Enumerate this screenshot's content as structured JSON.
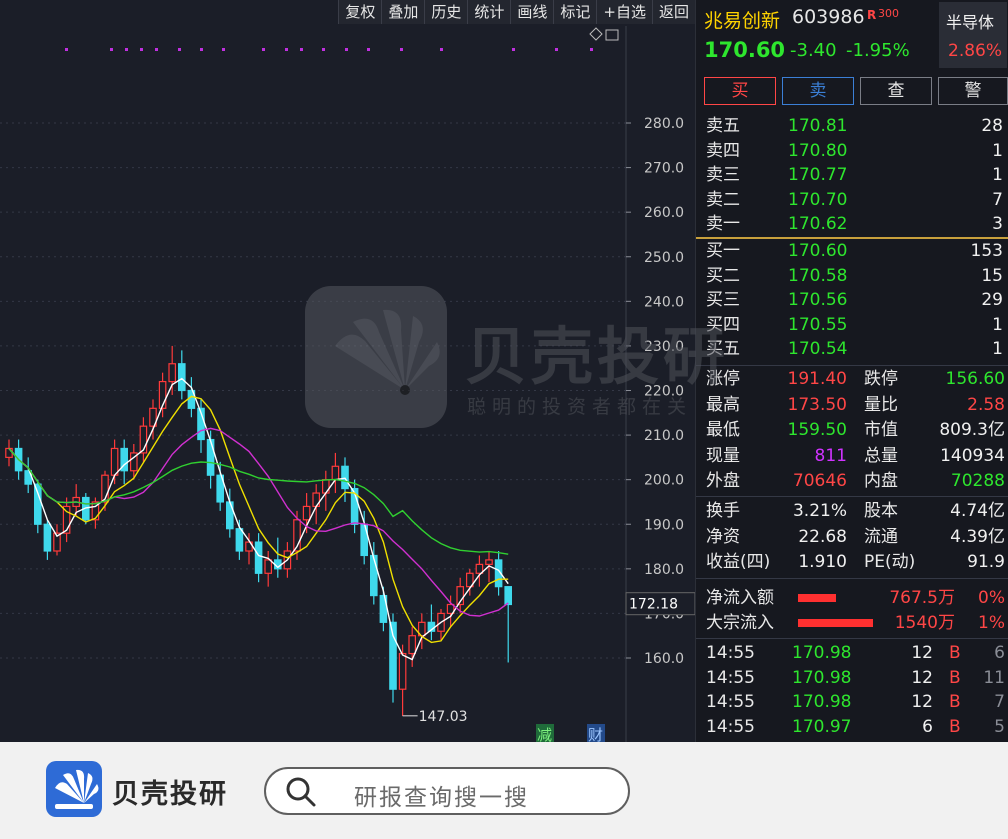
{
  "toolbar": {
    "buttons": [
      "复权",
      "叠加",
      "历史",
      "统计",
      "画线",
      "标记",
      "+自选",
      "返回"
    ]
  },
  "stock": {
    "name": "兆易创新",
    "code": "603986",
    "tag": "R",
    "tag_num": "300",
    "price": "170.60",
    "change": "-3.40",
    "change_pct": "-1.95%",
    "sector": "半导体",
    "sector_pct": "2.86%"
  },
  "actions": {
    "buy": "买",
    "sell": "卖",
    "check": "查",
    "alert": "警"
  },
  "asks": [
    {
      "label": "卖五",
      "price": "170.81",
      "vol": "28"
    },
    {
      "label": "卖四",
      "price": "170.80",
      "vol": "1"
    },
    {
      "label": "卖三",
      "price": "170.77",
      "vol": "1"
    },
    {
      "label": "卖二",
      "price": "170.70",
      "vol": "7"
    },
    {
      "label": "卖一",
      "price": "170.62",
      "vol": "3"
    }
  ],
  "bids": [
    {
      "label": "买一",
      "price": "170.60",
      "vol": "153"
    },
    {
      "label": "买二",
      "price": "170.58",
      "vol": "15"
    },
    {
      "label": "买三",
      "price": "170.56",
      "vol": "29"
    },
    {
      "label": "买四",
      "price": "170.55",
      "vol": "1"
    },
    {
      "label": "买五",
      "price": "170.54",
      "vol": "1"
    }
  ],
  "stats1": [
    {
      "l1": "涨停",
      "v1": "191.40",
      "c1": "red",
      "l2": "跌停",
      "v2": "156.60",
      "c2": "green"
    },
    {
      "l1": "最高",
      "v1": "173.50",
      "c1": "red",
      "l2": "量比",
      "v2": "2.58",
      "c2": "red"
    },
    {
      "l1": "最低",
      "v1": "159.50",
      "c1": "green",
      "l2": "市值",
      "v2": "809.3亿",
      "c2": "white"
    },
    {
      "l1": "现量",
      "v1": "811",
      "c1": "purple",
      "l2": "总量",
      "v2": "140934",
      "c2": "white"
    },
    {
      "l1": "外盘",
      "v1": "70646",
      "c1": "red",
      "l2": "内盘",
      "v2": "70288",
      "c2": "green"
    }
  ],
  "stats2": [
    {
      "l1": "换手",
      "v1": "3.21%",
      "l2": "股本",
      "v2": "4.74亿"
    },
    {
      "l1": "净资",
      "v1": "22.68",
      "l2": "流通",
      "v2": "4.39亿"
    },
    {
      "l1": "收益(四)",
      "v1": "1.910",
      "l2": "PE(动)",
      "v2": "91.9"
    }
  ],
  "flows": [
    {
      "label": "净流入额",
      "value": "767.5万",
      "pct": "0%",
      "bar": 0.3
    },
    {
      "label": "大宗流入",
      "value": "1540万",
      "pct": "1%",
      "bar": 0.6
    }
  ],
  "ticks": [
    {
      "time": "14:55",
      "price": "170.98",
      "vol": "12",
      "side": "B",
      "n": "6"
    },
    {
      "time": "14:55",
      "price": "170.98",
      "vol": "12",
      "side": "B",
      "n": "11"
    },
    {
      "time": "14:55",
      "price": "170.98",
      "vol": "12",
      "side": "B",
      "n": "7"
    },
    {
      "time": "14:55",
      "price": "170.97",
      "vol": "6",
      "side": "B",
      "n": "5"
    }
  ],
  "chart_data": {
    "type": "candlestick",
    "y_ticks": [
      "280.0",
      "270.0",
      "260.0",
      "250.0",
      "240.0",
      "230.0",
      "220.0",
      "210.0",
      "200.0",
      "190.0",
      "180.0",
      "170.0",
      "160.0"
    ],
    "ylim": [
      154,
      288
    ],
    "current_price_label": "172.18",
    "min_label": "147.03",
    "markers": [
      "减",
      "财"
    ],
    "candles": [
      [
        205,
        209,
        203,
        207
      ],
      [
        207,
        209,
        200,
        202
      ],
      [
        202,
        205,
        197,
        199
      ],
      [
        199,
        200,
        188,
        190
      ],
      [
        190,
        191,
        182,
        184
      ],
      [
        184,
        190,
        183,
        188
      ],
      [
        188,
        196,
        186,
        194
      ],
      [
        194,
        199,
        192,
        196
      ],
      [
        196,
        197,
        190,
        191
      ],
      [
        191,
        196,
        189,
        195
      ],
      [
        195,
        202,
        193,
        201
      ],
      [
        201,
        209,
        199,
        207
      ],
      [
        207,
        209,
        199,
        202
      ],
      [
        202,
        208,
        200,
        206
      ],
      [
        206,
        214,
        204,
        212
      ],
      [
        212,
        218,
        209,
        216
      ],
      [
        216,
        224,
        214,
        222
      ],
      [
        222,
        230,
        219,
        226
      ],
      [
        226,
        229,
        218,
        220
      ],
      [
        220,
        223,
        214,
        216
      ],
      [
        216,
        218,
        206,
        209
      ],
      [
        209,
        211,
        198,
        201
      ],
      [
        201,
        204,
        193,
        195
      ],
      [
        195,
        198,
        187,
        189
      ],
      [
        189,
        191,
        182,
        184
      ],
      [
        184,
        188,
        181,
        186
      ],
      [
        186,
        188,
        177,
        179
      ],
      [
        179,
        184,
        176,
        182
      ],
      [
        182,
        187,
        178,
        180
      ],
      [
        180,
        186,
        178,
        184
      ],
      [
        184,
        193,
        182,
        191
      ],
      [
        191,
        197,
        188,
        194
      ],
      [
        194,
        199,
        190,
        197
      ],
      [
        197,
        202,
        193,
        200
      ],
      [
        200,
        206,
        197,
        203
      ],
      [
        203,
        205,
        195,
        198
      ],
      [
        198,
        200,
        188,
        190
      ],
      [
        190,
        193,
        181,
        183
      ],
      [
        183,
        186,
        172,
        174
      ],
      [
        174,
        176,
        166,
        168
      ],
      [
        168,
        170,
        150,
        153
      ],
      [
        153,
        163,
        147,
        161
      ],
      [
        161,
        167,
        158,
        165
      ],
      [
        165,
        170,
        162,
        168
      ],
      [
        168,
        172,
        164,
        166
      ],
      [
        166,
        171,
        164,
        170
      ],
      [
        170,
        174,
        167,
        172
      ],
      [
        172,
        178,
        170,
        176
      ],
      [
        176,
        180,
        174,
        179
      ],
      [
        179,
        183,
        176,
        181
      ],
      [
        181,
        184,
        177,
        182
      ],
      [
        182,
        184,
        174,
        176
      ],
      [
        176,
        174,
        159,
        172
      ]
    ]
  }
}
